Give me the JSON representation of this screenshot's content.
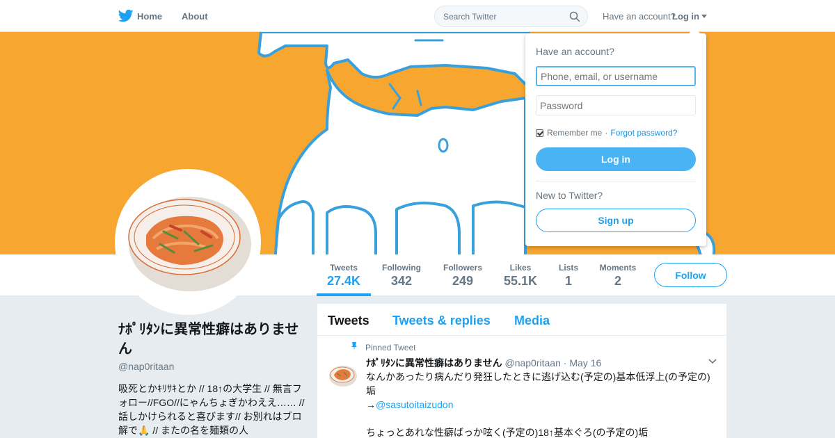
{
  "nav": {
    "home": "Home",
    "about": "About",
    "search_placeholder": "Search Twitter",
    "have_account": "Have an account?",
    "login": "Log in"
  },
  "stats": [
    {
      "label": "Tweets",
      "value": "27.4K",
      "active": true
    },
    {
      "label": "Following",
      "value": "342"
    },
    {
      "label": "Followers",
      "value": "249"
    },
    {
      "label": "Likes",
      "value": "55.1K"
    },
    {
      "label": "Lists",
      "value": "1"
    },
    {
      "label": "Moments",
      "value": "2"
    }
  ],
  "follow_label": "Follow",
  "profile": {
    "name": "ﾅﾎﾟﾘﾀﾝに異常性癖はありません",
    "handle": "@nap0ritaan",
    "bio": "吸死とかｷﾘｻｷとか // 18↑の大学生 // 無言フォロー//FGO//にゃんちょぎかわええ…… // 話しかけられると喜びます// お別れはブロ解で🙏 // またの名を麺類の人"
  },
  "timeline": {
    "tabs": [
      "Tweets",
      "Tweets & replies",
      "Media"
    ],
    "pinned_label": "Pinned Tweet",
    "tweet": {
      "name": "ﾅﾎﾟﾘﾀﾝに異常性癖はありません",
      "handle": "@nap0ritaan",
      "separator": "·",
      "date": "May 16",
      "line1": "なんかあったり病んだり発狂したときに逃げ込む(予定の)基本低浮上(の予定の)垢",
      "arrow": "→",
      "mention": "@sasutoitaizudon",
      "line3": "ちょっとあれな性癖ばっか呟く(予定の)18↑基本ぐろ(の予定の)垢"
    }
  },
  "login_dropdown": {
    "title": "Have an account?",
    "username_placeholder": "Phone, email, or username",
    "password_placeholder": "Password",
    "remember": "Remember me",
    "dot": "·",
    "forgot": "Forgot password?",
    "login_button": "Log in",
    "new_to_twitter": "New to Twitter?",
    "signup_button": "Sign up"
  },
  "colors": {
    "accent": "#1da1f2",
    "banner": "#f7a62f"
  }
}
